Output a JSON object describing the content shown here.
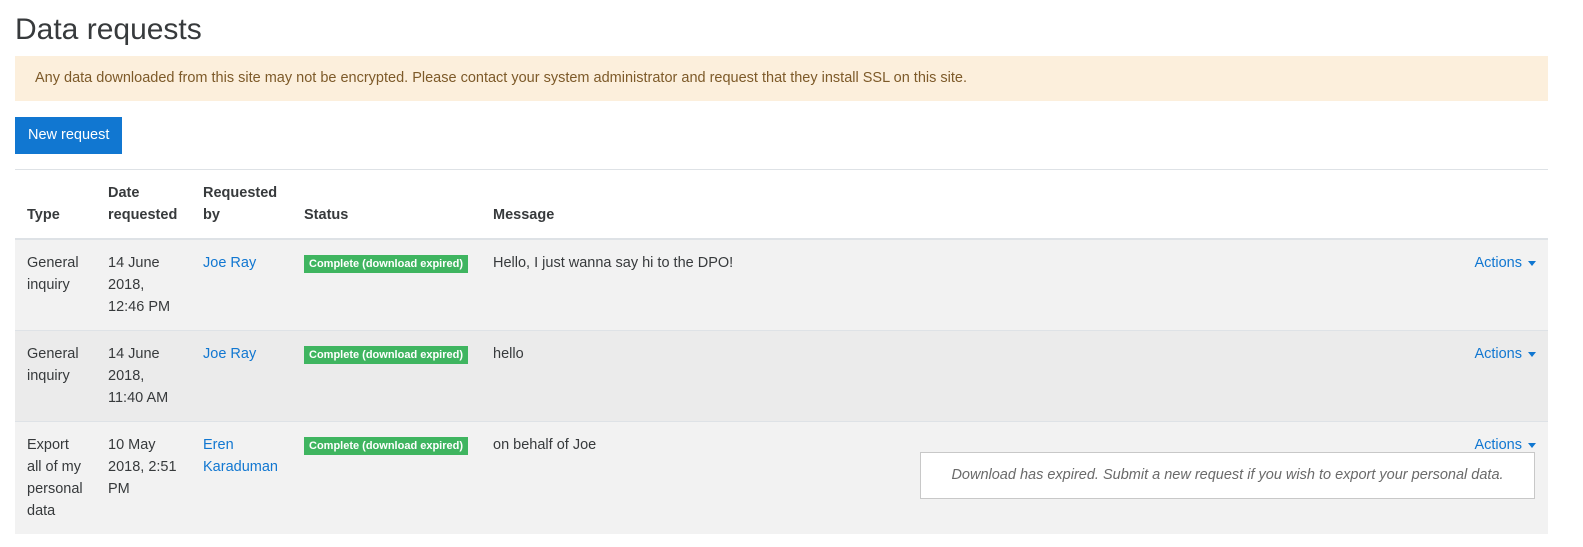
{
  "page": {
    "title": "Data requests"
  },
  "alert": {
    "text": "Any data downloaded from this site may not be encrypted. Please contact your system administrator and request that they install SSL on this site."
  },
  "toolbar": {
    "new_request_label": "New request"
  },
  "table": {
    "headers": {
      "type": "Type",
      "date": "Date requested",
      "requested_by": "Requested by",
      "status": "Status",
      "message": "Message"
    },
    "rows": [
      {
        "type": "General inquiry",
        "date": "14 June 2018, 12:46 PM",
        "requested_by": "Joe Ray",
        "status": "Complete (download expired)",
        "message": "Hello, I just wanna say hi to the DPO!",
        "actions": "Actions"
      },
      {
        "type": "General inquiry",
        "date": "14 June 2018, 11:40 AM",
        "requested_by": "Joe Ray",
        "status": "Complete (download expired)",
        "message": "hello",
        "actions": "Actions"
      },
      {
        "type": "Export all of my personal data",
        "date": "10 May 2018, 2:51 PM",
        "requested_by": "Eren Karaduman",
        "status": "Complete (download expired)",
        "message": "on behalf of Joe",
        "actions": "Actions"
      }
    ],
    "expired_note": "Download has expired. Submit a new request if you wish to export your personal data."
  },
  "colors": {
    "primary": "#1177d1",
    "badge_success": "#3fb560",
    "alert_bg": "#fcefdc",
    "alert_text": "#7d5a29"
  }
}
